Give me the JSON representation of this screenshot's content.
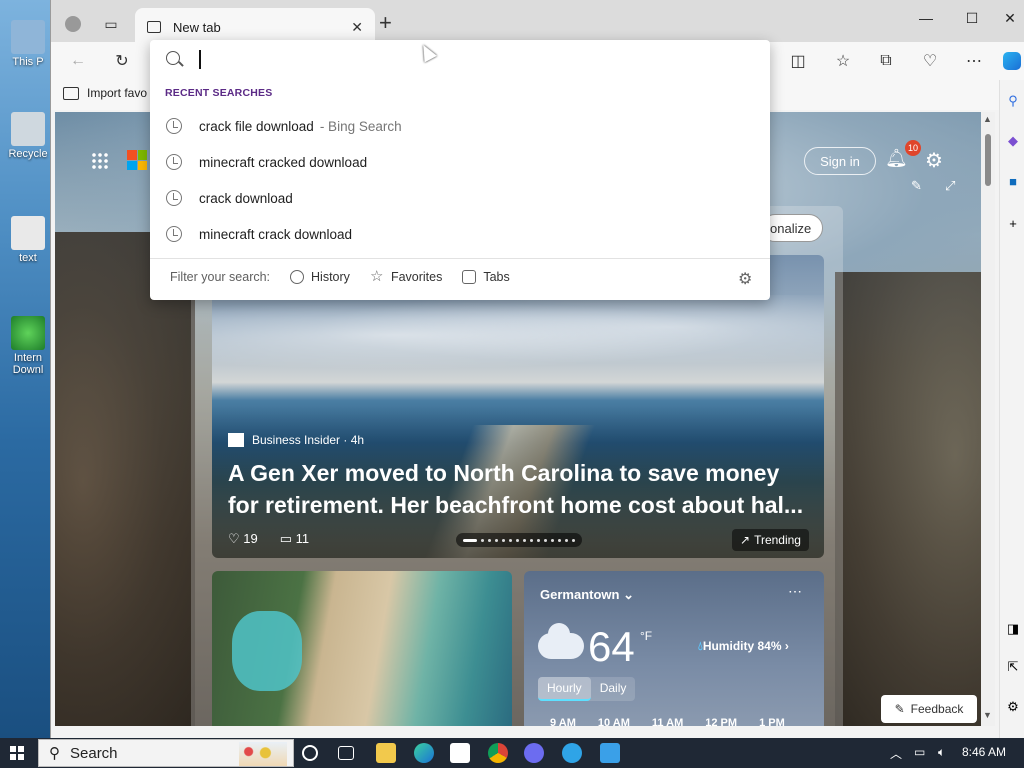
{
  "desktop": {
    "icons": [
      {
        "label": "This P"
      },
      {
        "label": "Recycle"
      },
      {
        "label": "text"
      },
      {
        "label": "Intern Downl"
      }
    ]
  },
  "browser": {
    "tab_title": "New tab",
    "favorites_bar": {
      "import_label": "Import favo"
    },
    "omnibox": {
      "value": "",
      "section_heading": "RECENT SEARCHES",
      "recent_searches": [
        {
          "text": "crack file download",
          "suffix": "- Bing Search"
        },
        {
          "text": "minecraft cracked download",
          "suffix": ""
        },
        {
          "text": "crack download",
          "suffix": ""
        },
        {
          "text": "minecraft crack download",
          "suffix": ""
        }
      ],
      "filter_label": "Filter your search:",
      "filters": [
        "History",
        "Favorites",
        "Tabs"
      ]
    }
  },
  "msn": {
    "signin_label": "Sign in",
    "notification_count": "10",
    "personalize_label": "onalize",
    "hero": {
      "source": "Business Insider · 4h",
      "title": "A Gen Xer moved to North Carolina to save money for retirement. Her beachfront home cost about hal...",
      "likes": "19",
      "comments": "11",
      "trending_label": "Trending"
    },
    "weather": {
      "location": "Germantown",
      "temperature": "64",
      "unit": "°F",
      "humidity": "Humidity 84%",
      "tabs": [
        "Hourly",
        "Daily"
      ],
      "hours": [
        "9 AM",
        "10 AM",
        "11 AM",
        "12 PM",
        "1 PM"
      ]
    },
    "feedback_label": "Feedback"
  },
  "taskbar": {
    "search_label": "Search",
    "time": "8:46 AM"
  }
}
